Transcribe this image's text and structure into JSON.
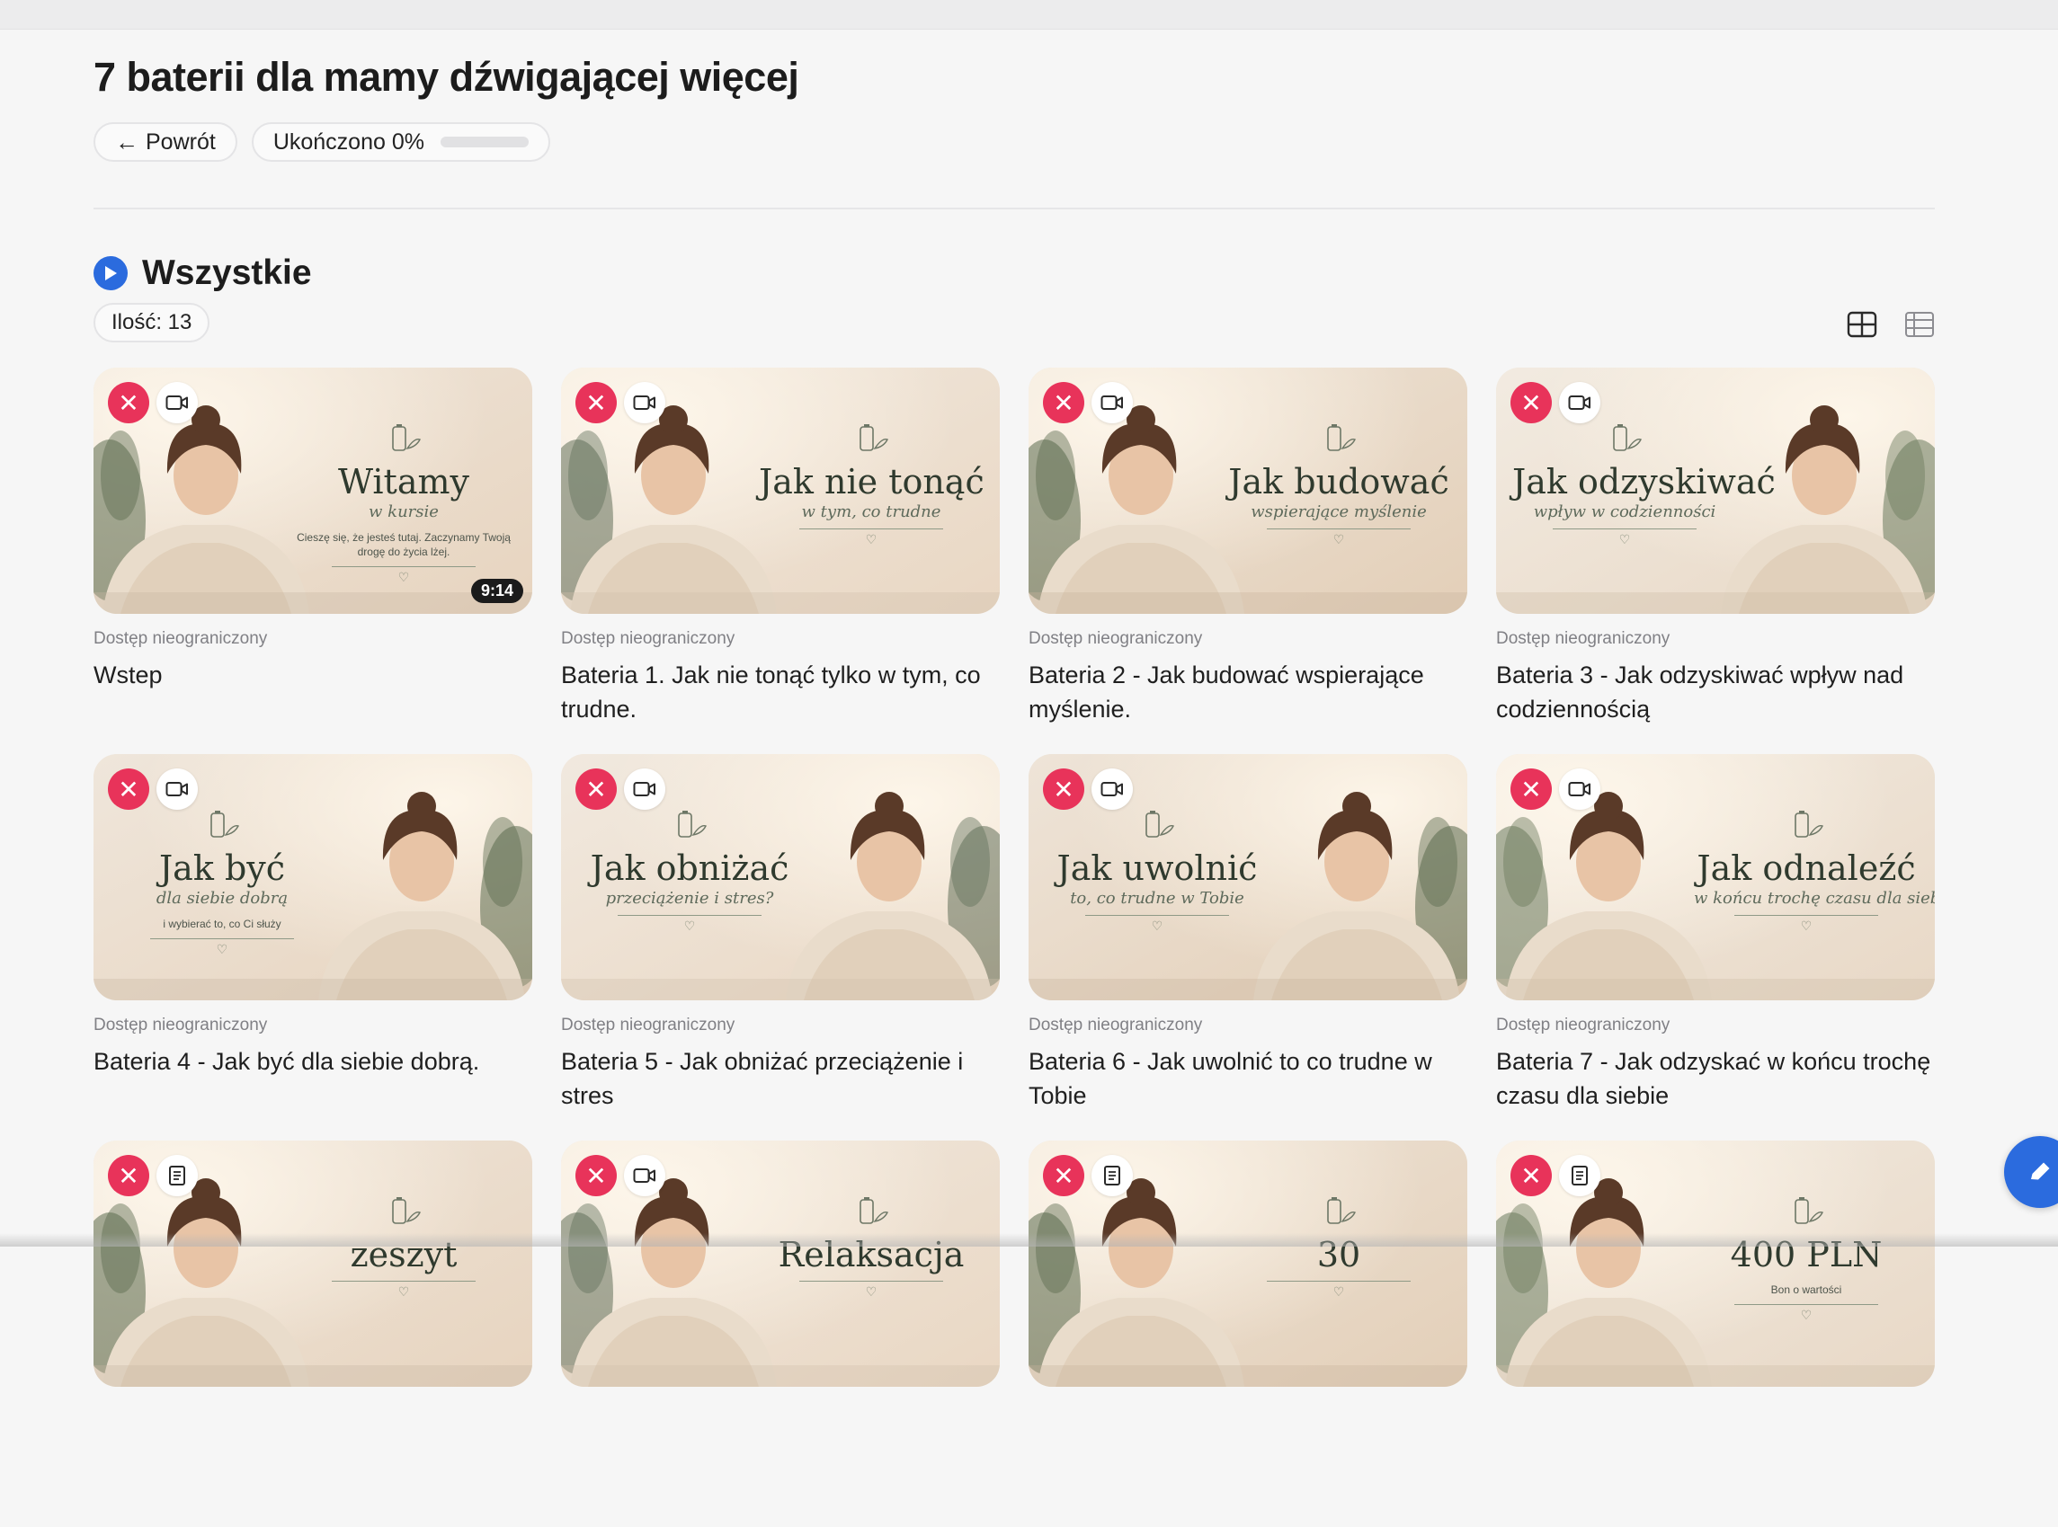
{
  "page": {
    "title": "7 baterii dla mamy dźwigającej więcej",
    "back_label": "Powrót",
    "progress_label": "Ukończono 0%",
    "progress_fraction": 0
  },
  "section": {
    "title": "Wszystkie",
    "count_label": "Ilość: 13"
  },
  "colors": {
    "accent": "#2b6bde",
    "remove": "#e8335a",
    "thumb_text": "#2f3a2e"
  },
  "cards": [
    {
      "type_icon": "video-icon",
      "access": "Dostęp nieograniczony",
      "title": "Wstep",
      "duration": "9:14",
      "thumb_big": "Witamy",
      "thumb_sub": "w kursie",
      "thumb_tag": "Cieszę się, że jesteś tutaj. Zaczynamy Twoją drogę do życia lżej."
    },
    {
      "type_icon": "video-icon",
      "access": "Dostęp nieograniczony",
      "title": "Bateria 1. Jak nie tonąć tylko w tym, co trudne.",
      "thumb_big": "Jak nie tonąć",
      "thumb_sub": "w tym, co trudne"
    },
    {
      "type_icon": "video-icon",
      "access": "Dostęp nieograniczony",
      "title": "Bateria 2 - Jak budować wspierające myślenie.",
      "thumb_big": "Jak budować",
      "thumb_sub": "wspierające myślenie"
    },
    {
      "type_icon": "video-icon",
      "access": "Dostęp nieograniczony",
      "title": "Bateria 3 - Jak odzyskiwać wpływ nad codziennością",
      "thumb_big": "Jak odzyskiwać",
      "thumb_sub": "wpływ w codzienności"
    },
    {
      "type_icon": "video-icon",
      "access": "Dostęp nieograniczony",
      "title": "Bateria 4 - Jak być dla siebie dobrą.",
      "thumb_big": "Jak być",
      "thumb_sub": "dla siebie dobrą",
      "thumb_tag": "i wybierać to, co Ci służy"
    },
    {
      "type_icon": "video-icon",
      "access": "Dostęp nieograniczony",
      "title": "Bateria 5 - Jak obniżać przeciążenie i stres",
      "thumb_big": "Jak obniżać",
      "thumb_sub": "przeciążenie i stres?"
    },
    {
      "type_icon": "video-icon",
      "access": "Dostęp nieograniczony",
      "title": "Bateria 6 - Jak uwolnić to co trudne w Tobie",
      "thumb_big": "Jak uwolnić",
      "thumb_sub": "to, co trudne w Tobie"
    },
    {
      "type_icon": "video-icon",
      "access": "Dostęp nieograniczony",
      "title": "Bateria 7 - Jak odzyskać w końcu trochę czasu dla siebie",
      "thumb_big": "Jak odnaleźć",
      "thumb_sub": "w końcu trochę czasu dla siebie"
    },
    {
      "type_icon": "document-icon",
      "access": "",
      "title": "",
      "thumb_big": "zeszyt",
      "thumb_sub": ""
    },
    {
      "type_icon": "video-icon",
      "access": "",
      "title": "",
      "thumb_big": "Relaksacja",
      "thumb_sub": ""
    },
    {
      "type_icon": "document-icon",
      "access": "",
      "title": "",
      "thumb_big": "30",
      "thumb_sub": ""
    },
    {
      "type_icon": "document-icon",
      "access": "",
      "title": "",
      "thumb_big": "400 PLN",
      "thumb_sub": "",
      "thumb_tag": "Bon o wartości"
    }
  ]
}
